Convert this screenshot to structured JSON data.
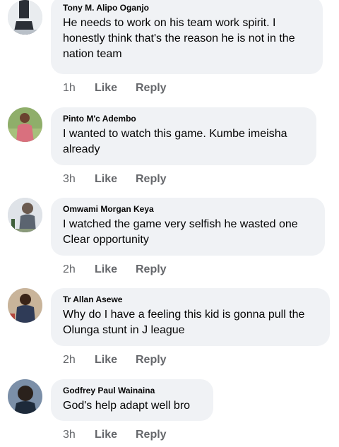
{
  "comments": [
    {
      "author": "Tony M. Alipo Oganjo",
      "text": "He needs to work on his team work spirit. I honestly think that's the reason he is not in the nation team",
      "time": "1h",
      "like": "Like",
      "reply": "Reply",
      "avatar_colors": {
        "bg": "#e9ecef",
        "figure": "#2b2f36"
      }
    },
    {
      "author": "Pinto M'c Adembo",
      "text": "I wanted to watch this game. Kumbe imeisha already",
      "time": "3h",
      "like": "Like",
      "reply": "Reply",
      "avatar_colors": {
        "bg": "#8fae6a",
        "figure": "#d9707e"
      }
    },
    {
      "author": "Omwami Morgan Keya",
      "text": "I watched the game very selfish he wasted one Clear opportunity",
      "time": "2h",
      "like": "Like",
      "reply": "Reply",
      "avatar_colors": {
        "bg": "#dfe3e8",
        "figure": "#5b6470"
      }
    },
    {
      "author": "Tr Allan Asewe",
      "text": "Why do I have a feeling this kid is gonna pull the Olunga stunt in J league",
      "time": "2h",
      "like": "Like",
      "reply": "Reply",
      "avatar_colors": {
        "bg": "#c9b49a",
        "figure": "#2f3b57"
      }
    },
    {
      "author": "Godfrey Paul Wainaina",
      "text": "God's help adapt well bro",
      "time": "3h",
      "like": "Like",
      "reply": "Reply",
      "avatar_colors": {
        "bg": "#7b8fa8",
        "figure": "#2a211c"
      }
    }
  ]
}
